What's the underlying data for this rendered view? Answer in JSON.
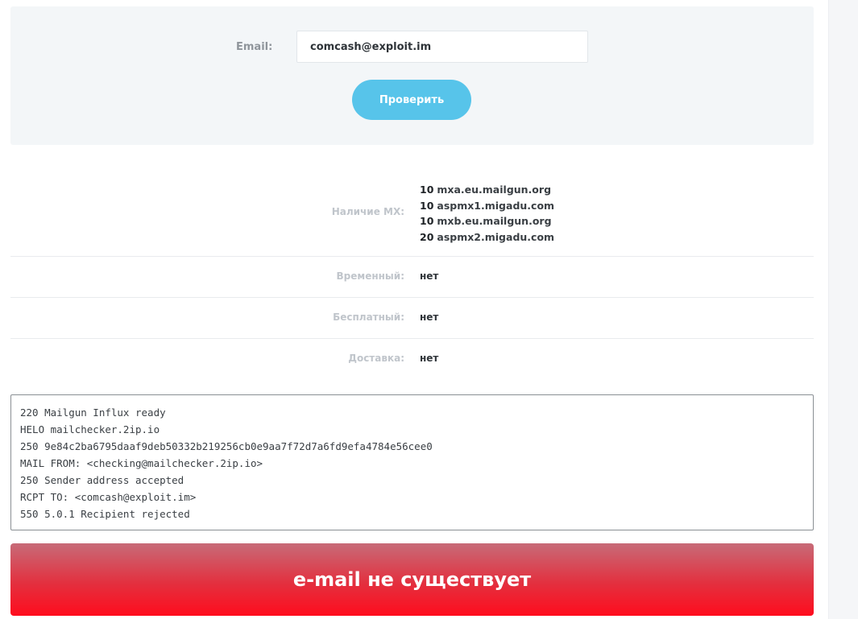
{
  "form": {
    "email_label": "Email:",
    "email_value": "comcash@exploit.im",
    "check_button": "Проверить"
  },
  "results": {
    "mx_label": "Наличие MX:",
    "mx_records": [
      {
        "priority": "10",
        "host": "mxa.eu.mailgun.org"
      },
      {
        "priority": "10",
        "host": "aspmx1.migadu.com"
      },
      {
        "priority": "10",
        "host": "mxb.eu.mailgun.org"
      },
      {
        "priority": "20",
        "host": "aspmx2.migadu.com"
      }
    ],
    "temporary_label": "Временный:",
    "temporary_value": "нет",
    "free_label": "Бесплатный:",
    "free_value": "нет",
    "delivery_label": "Доставка:",
    "delivery_value": "нет"
  },
  "smtp_log": [
    "220 Mailgun Influx ready",
    "HELO mailchecker.2ip.io",
    "250 9e84c2ba6795daaf9deb50332b219256cb0e9aa7f72d7a6fd9efa4784e56cee0",
    "MAIL FROM: <checking@mailchecker.2ip.io>",
    "250 Sender address accepted",
    "RCPT TO: <comcash@exploit.im>",
    "550 5.0.1 Recipient rejected"
  ],
  "verdict": {
    "text": "e-mail не существует",
    "color": "#ff0c1d"
  },
  "colors": {
    "accent": "#57c4ea",
    "panel_bg": "#f3f6f8"
  }
}
